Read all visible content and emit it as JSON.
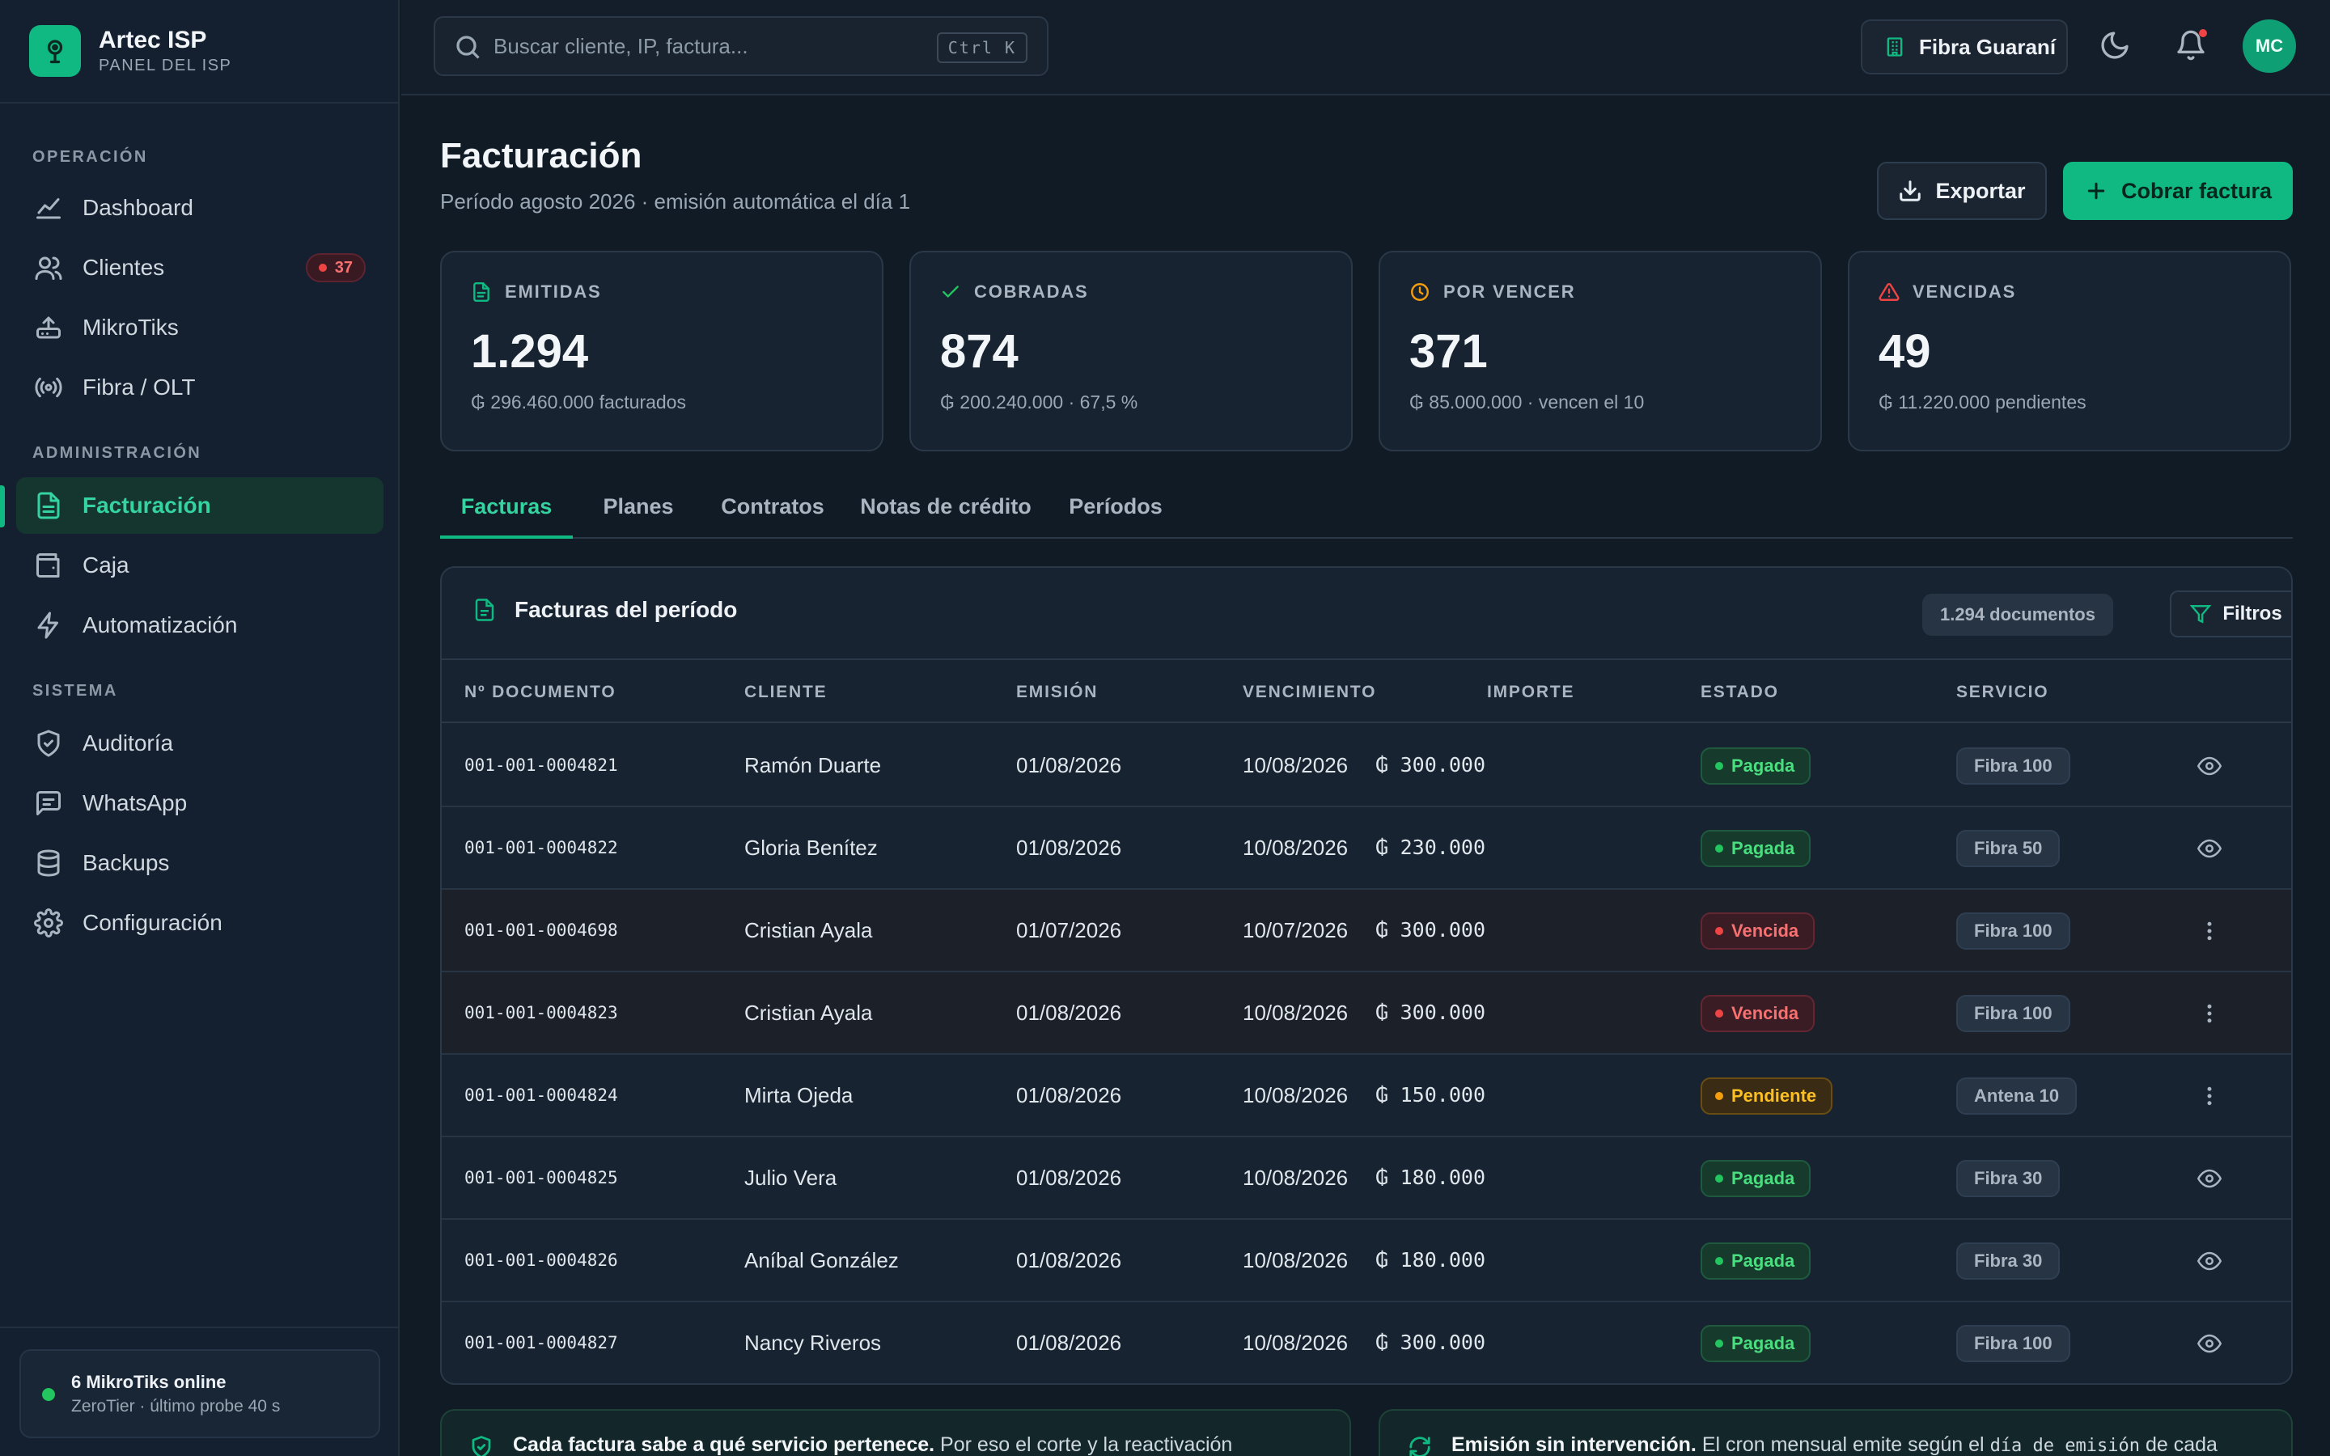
{
  "brand": {
    "name": "Artec ISP",
    "subtitle": "PANEL DEL ISP"
  },
  "sidebar": {
    "sections": [
      "OPERACIÓN",
      "ADMINISTRACIÓN",
      "SISTEMA"
    ],
    "items": [
      {
        "label": "Dashboard",
        "icon": "chart-line-icon"
      },
      {
        "label": "Clientes",
        "icon": "users-icon",
        "badge": "37"
      },
      {
        "label": "MikroTiks",
        "icon": "router-icon"
      },
      {
        "label": "Fibra / OLT",
        "icon": "signal-icon"
      },
      {
        "label": "Facturación",
        "icon": "invoice-icon",
        "active": true
      },
      {
        "label": "Caja",
        "icon": "wallet-icon"
      },
      {
        "label": "Automatización",
        "icon": "bolt-icon"
      },
      {
        "label": "Auditoría",
        "icon": "shield-check-icon"
      },
      {
        "label": "WhatsApp",
        "icon": "message-icon"
      },
      {
        "label": "Backups",
        "icon": "database-icon"
      },
      {
        "label": "Configuración",
        "icon": "gear-icon"
      }
    ],
    "status": {
      "title": "6 MikroTiks online",
      "subtitle": "ZeroTier · último probe 40 s",
      "color": "#22c55e"
    }
  },
  "topbar": {
    "search_placeholder": "Buscar cliente, IP, factura...",
    "shortcut": "Ctrl K",
    "org": "Fibra Guaraní",
    "avatar_initials": "MC"
  },
  "page": {
    "title": "Facturación",
    "subtitle": "Período agosto 2026 · emisión automática el día 1",
    "export_label": "Exportar",
    "primary_label": "Cobrar factura"
  },
  "stats": [
    {
      "label": "EMITIDAS",
      "value": "1.294",
      "sub": "₲ 296.460.000 facturados",
      "color": "#10b981"
    },
    {
      "label": "COBRADAS",
      "value": "874",
      "sub": "₲ 200.240.000 · 67,5 %",
      "color": "#22c55e"
    },
    {
      "label": "POR VENCER",
      "value": "371",
      "sub": "₲ 85.000.000 · vencen el 10",
      "color": "#f59e0b"
    },
    {
      "label": "VENCIDAS",
      "value": "49",
      "sub": "₲ 11.220.000 pendientes",
      "color": "#ef4444"
    }
  ],
  "tabs": [
    "Facturas",
    "Planes",
    "Contratos",
    "Notas de crédito",
    "Períodos"
  ],
  "table": {
    "title": "Facturas del período",
    "count": "1.294 documentos",
    "filter_label": "Filtros",
    "columns": [
      "Nº DOCUMENTO",
      "CLIENTE",
      "EMISIÓN",
      "VENCIMIENTO",
      "IMPORTE",
      "ESTADO",
      "SERVICIO"
    ],
    "rows": [
      {
        "doc": "001-001-0004821",
        "client": "Ramón Duarte",
        "issued": "01/08/2026",
        "due": "10/08/2026",
        "amount": "₲ 300.000",
        "status": "Pagada",
        "service": "Fibra 100"
      },
      {
        "doc": "001-001-0004822",
        "client": "Gloria Benítez",
        "issued": "01/08/2026",
        "due": "10/08/2026",
        "amount": "₲ 230.000",
        "status": "Pagada",
        "service": "Fibra 50"
      },
      {
        "doc": "001-001-0004698",
        "client": "Cristian Ayala",
        "issued": "01/07/2026",
        "due": "10/07/2026",
        "amount": "₲ 300.000",
        "status": "Vencida",
        "service": "Fibra 100"
      },
      {
        "doc": "001-001-0004823",
        "client": "Cristian Ayala",
        "issued": "01/08/2026",
        "due": "10/08/2026",
        "amount": "₲ 300.000",
        "status": "Vencida",
        "service": "Fibra 100"
      },
      {
        "doc": "001-001-0004824",
        "client": "Mirta Ojeda",
        "issued": "01/08/2026",
        "due": "10/08/2026",
        "amount": "₲ 150.000",
        "status": "Pendiente",
        "service": "Antena 10"
      },
      {
        "doc": "001-001-0004825",
        "client": "Julio Vera",
        "issued": "01/08/2026",
        "due": "10/08/2026",
        "amount": "₲ 180.000",
        "status": "Pagada",
        "service": "Fibra 30"
      },
      {
        "doc": "001-001-0004826",
        "client": "Aníbal González",
        "issued": "01/08/2026",
        "due": "10/08/2026",
        "amount": "₲ 180.000",
        "status": "Pagada",
        "service": "Fibra 30"
      },
      {
        "doc": "001-001-0004827",
        "client": "Nancy Riveros",
        "issued": "01/08/2026",
        "due": "10/08/2026",
        "amount": "₲ 300.000",
        "status": "Pagada",
        "service": "Fibra 100"
      }
    ]
  },
  "info": {
    "left_bold": "Cada factura sabe a qué servicio pertenece.",
    "left_text": "Por eso el corte y la reactivación",
    "right_bold": "Emisión sin intervención.",
    "right_text": "El cron mensual emite según el",
    "right_code": "día de emisión",
    "right_tail": "de cada"
  },
  "colors": {
    "accent": "#10b981",
    "background": "#111b25",
    "danger": "#ef4444",
    "warning": "#f59e0b"
  }
}
